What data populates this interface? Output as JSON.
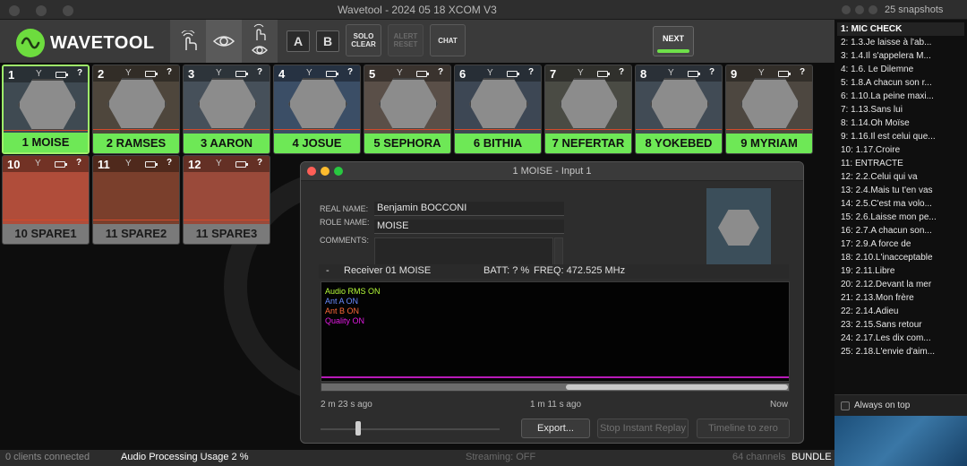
{
  "app": {
    "title": "Wavetool - 2024 05 18 XCOM V3",
    "logo_text": "WAVETOOL"
  },
  "toolbar": {
    "a_label": "A",
    "b_label": "B",
    "solo_label": "SOLO CLEAR",
    "alert_label": "ALERT RESET",
    "chat_label": "CHAT",
    "next_label": "NEXT",
    "icons": [
      "hand-tap-icon",
      "eye-icon",
      "hand-eye-icon"
    ]
  },
  "channels": [
    {
      "num": "1",
      "name": "1 MOISE",
      "state": "active",
      "selected": true
    },
    {
      "num": "2",
      "name": "2 RAMSES",
      "state": "active"
    },
    {
      "num": "3",
      "name": "3 AARON",
      "state": "active"
    },
    {
      "num": "4",
      "name": "4 JOSUE",
      "state": "active"
    },
    {
      "num": "5",
      "name": "5 SEPHORA",
      "state": "active"
    },
    {
      "num": "6",
      "name": "6 BITHIA",
      "state": "active"
    },
    {
      "num": "7",
      "name": "7 NEFERTAR",
      "state": "active"
    },
    {
      "num": "8",
      "name": "8 YOKEBED",
      "state": "active"
    },
    {
      "num": "9",
      "name": "9 MYRIAM",
      "state": "active"
    },
    {
      "num": "10",
      "name": "10 SPARE1",
      "state": "spare"
    },
    {
      "num": "11",
      "name": "11 SPARE2",
      "state": "spare"
    },
    {
      "num": "12",
      "name": "11 SPARE3",
      "state": "spare"
    }
  ],
  "channel_icons": {
    "antenna": "Ἆ",
    "q": "?"
  },
  "dialog": {
    "title": "1 MOISE - Input 1",
    "real_name_label": "REAL NAME:",
    "real_name": "Benjamin BOCCONI",
    "role_name_label": "ROLE NAME:",
    "role_name": "MOISE",
    "comments_label": "COMMENTS:",
    "comments": "",
    "collapse": "-",
    "receiver": "Receiver 01 MOISE",
    "batt": "BATT: ? %",
    "freq": "FREQ: 472.525 MHz",
    "legend": [
      {
        "label": "Audio RMS ON",
        "color": "#b8ff3a"
      },
      {
        "label": "Ant A ON",
        "color": "#6a8cff"
      },
      {
        "label": "Ant B ON",
        "color": "#ff6a3a"
      },
      {
        "label": "Quality ON",
        "color": "#e21ae2"
      }
    ],
    "time_left": "2 m 23 s ago",
    "time_mid": "1 m 11 s ago",
    "time_right": "Now",
    "export_label": "Export...",
    "replay_label": "Stop Instant Replay",
    "timeline_label": "Timeline to zero"
  },
  "status": {
    "clients": "0 clients connected",
    "audio_usage": "Audio Processing Usage 2 %",
    "streaming": "Streaming: OFF",
    "channels": "64 channels",
    "bundle": "BUNDLE"
  },
  "snapshots": {
    "title": "25 snapshots",
    "items": [
      "1: MIC CHECK",
      "2: 1.3.Je laisse à l'ab...",
      "3: 1.4.Il s'appelera M...",
      "4: 1.6. Le Dilemne",
      "5: 1.8.A chacun son r...",
      "6: 1.10.La peine maxi...",
      "7: 1.13.Sans lui",
      "8: 1.14.Oh Moïse",
      "9: 1.16.Il est celui que...",
      "10: 1.17.Croire",
      "11: ENTRACTE",
      "12: 2.2.Celui qui va",
      "13: 2.4.Mais tu t'en vas",
      "14: 2.5.C'est ma volo...",
      "15: 2.6.Laisse mon pe...",
      "16: 2.7.A chacun son...",
      "17: 2.9.A force de",
      "18: 2.10.L'inacceptable",
      "19: 2.11.Libre",
      "20: 2.12.Devant la mer",
      "21: 2.13.Mon frère",
      "22: 2.14.Adieu",
      "23: 2.15.Sans retour",
      "24: 2.17.Les dix com...",
      "25: 2.18.L'envie d'aim..."
    ],
    "active_index": 0,
    "always_on_top": "Always on top"
  }
}
